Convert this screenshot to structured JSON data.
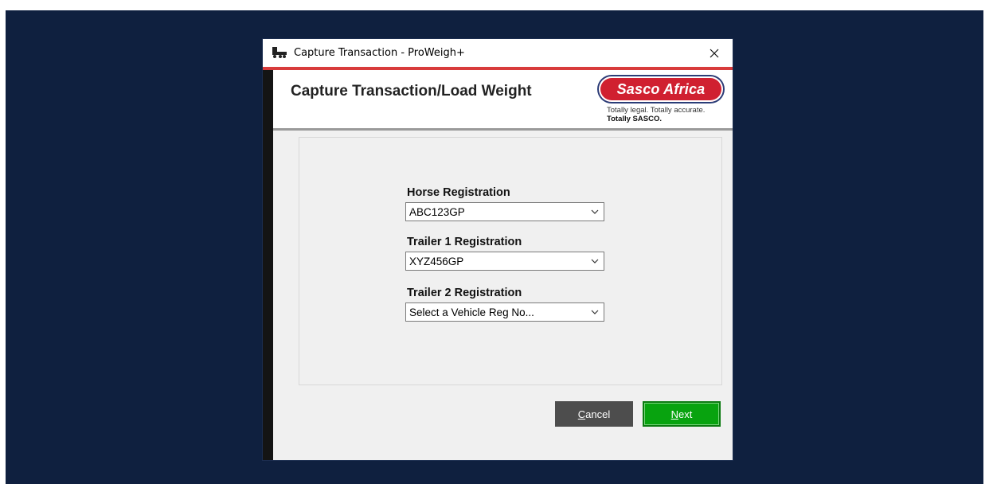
{
  "window": {
    "title": "Capture Transaction - ProWeigh+",
    "close_label": "×"
  },
  "header": {
    "title": "Capture Transaction/Load Weight",
    "logo_text": "Sasco Africa",
    "tagline_1": "Totally legal. Totally accurate.",
    "tagline_2": "Totally SASCO."
  },
  "form": {
    "horse": {
      "label": "Horse Registration",
      "value": "ABC123GP"
    },
    "trailer1": {
      "label": "Trailer 1 Registration",
      "value": "XYZ456GP"
    },
    "trailer2": {
      "label": "Trailer 2 Registration",
      "value": "Select a Vehicle Reg No..."
    }
  },
  "buttons": {
    "cancel_first": "C",
    "cancel_rest": "ancel",
    "next_first": "N",
    "next_rest": "ext"
  },
  "colors": {
    "backdrop": "#0f203f",
    "accent_red": "#d83b3b",
    "next_green": "#08a30f",
    "cancel_gray": "#4d4d4d"
  },
  "icons": {
    "title_icon": "truck-icon",
    "close_icon": "close-icon",
    "dropdown_icon": "chevron-down-icon"
  }
}
